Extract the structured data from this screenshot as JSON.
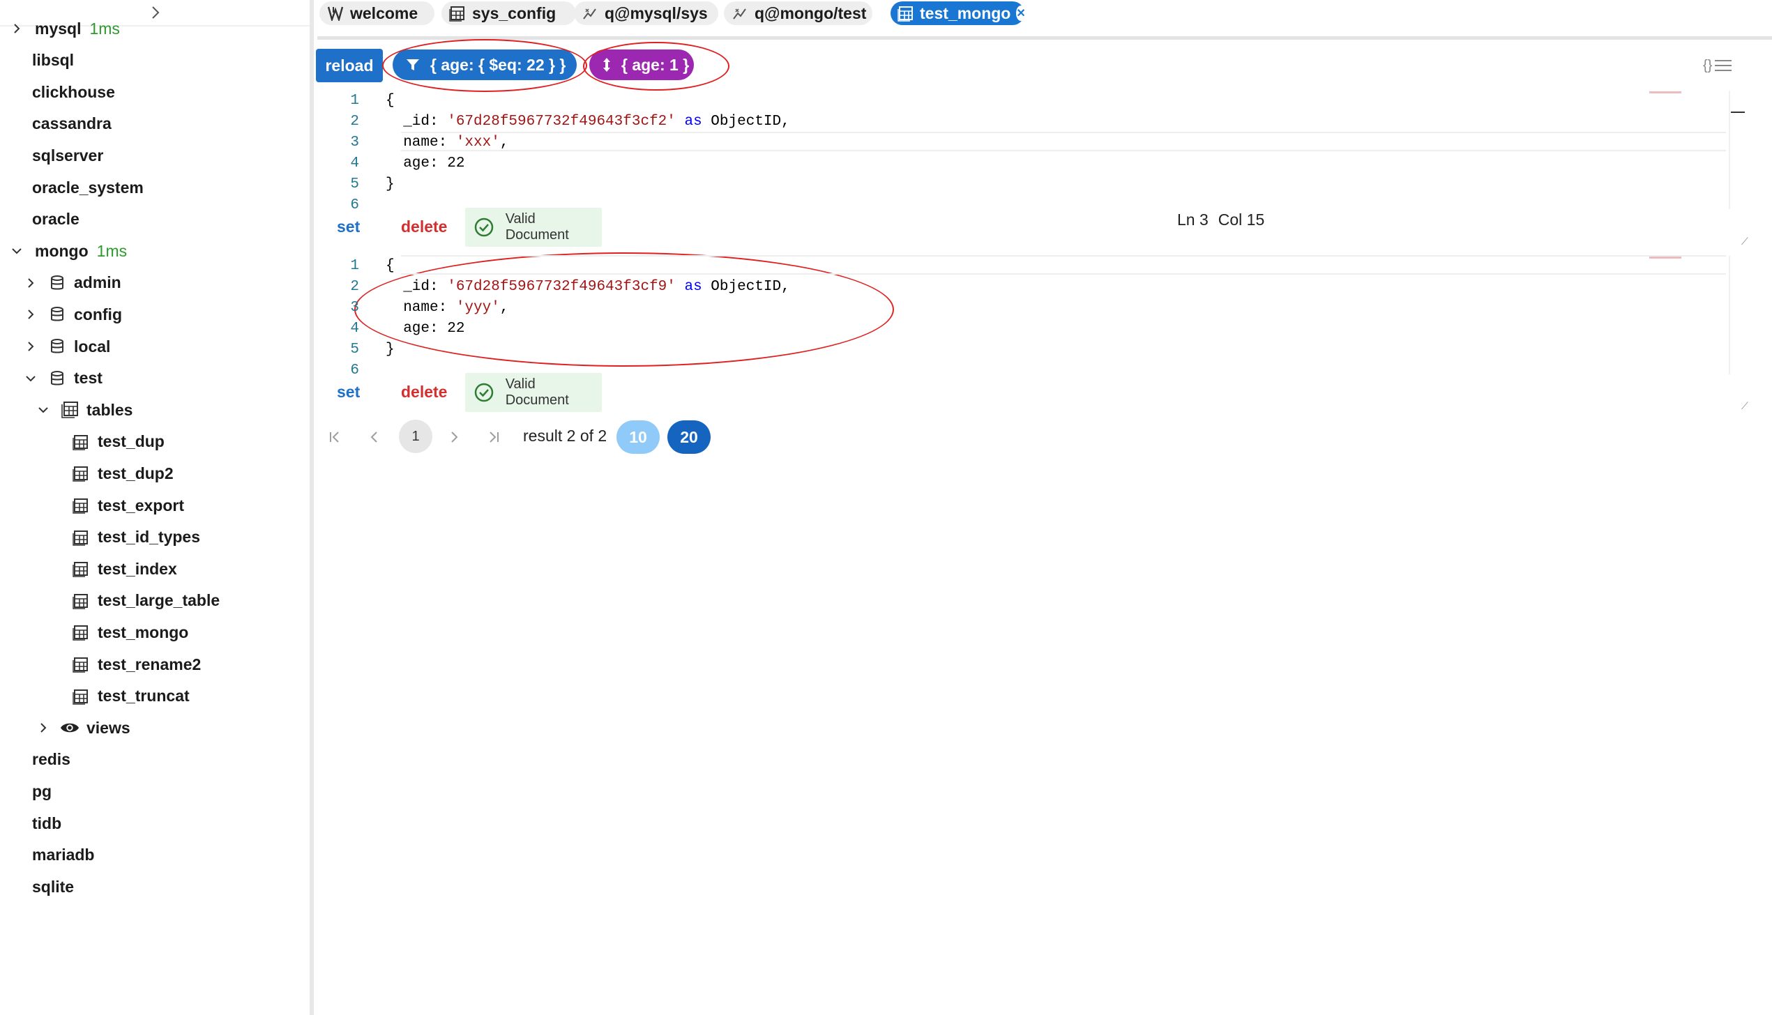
{
  "sidebar": {
    "items": [
      {
        "label": "mysql",
        "latency": "1ms",
        "expanded": false
      },
      {
        "label": "libsql"
      },
      {
        "label": "clickhouse"
      },
      {
        "label": "cassandra"
      },
      {
        "label": "sqlserver"
      },
      {
        "label": "oracle_system"
      },
      {
        "label": "oracle"
      },
      {
        "label": "mongo",
        "latency": "1ms",
        "expanded": true
      },
      {
        "label": "admin",
        "icon": "database-icon"
      },
      {
        "label": "config",
        "icon": "database-icon"
      },
      {
        "label": "local",
        "icon": "database-icon"
      },
      {
        "label": "test",
        "icon": "database-icon"
      },
      {
        "label": "tables",
        "icon": "table-group-icon"
      },
      {
        "label": "test_dup",
        "icon": "table-icon"
      },
      {
        "label": "test_dup2",
        "icon": "table-icon"
      },
      {
        "label": "test_export",
        "icon": "table-icon"
      },
      {
        "label": "test_id_types",
        "icon": "table-icon"
      },
      {
        "label": "test_index",
        "icon": "table-icon"
      },
      {
        "label": "test_large_table",
        "icon": "table-icon"
      },
      {
        "label": "test_mongo",
        "icon": "table-icon"
      },
      {
        "label": "test_rename2",
        "icon": "table-icon"
      },
      {
        "label": "test_truncat",
        "icon": "table-icon"
      },
      {
        "label": "views",
        "icon": "eye-icon"
      },
      {
        "label": "redis"
      },
      {
        "label": "pg"
      },
      {
        "label": "tidb"
      },
      {
        "label": "mariadb"
      },
      {
        "label": "sqlite"
      }
    ]
  },
  "tabs": [
    {
      "label": "welcome",
      "icon": "logo-icon"
    },
    {
      "label": "sys_config",
      "icon": "table-icon"
    },
    {
      "label": "q@mysql/sys",
      "icon": "query-icon"
    },
    {
      "label": "q@mongo/test",
      "icon": "query-icon"
    },
    {
      "label": "test_mongo",
      "icon": "table-icon",
      "active": true
    }
  ],
  "toolbar": {
    "reload_label": "reload",
    "filter_label": "{ age: { $eq: 22 } }",
    "sort_label": "{ age: 1 }"
  },
  "documents": [
    {
      "lines": [
        {
          "n": "1",
          "parts": [
            [
              "p",
              "{"
            ]
          ]
        },
        {
          "n": "2",
          "parts": [
            [
              "p",
              "  _id: "
            ],
            [
              "s",
              "'67d28f5967732f49643f3cf2'"
            ],
            [
              "p",
              " "
            ],
            [
              "k",
              "as"
            ],
            [
              "p",
              " ObjectID,"
            ]
          ]
        },
        {
          "n": "3",
          "parts": [
            [
              "p",
              "  name: "
            ],
            [
              "s",
              "'xxx'"
            ],
            [
              "p",
              ","
            ]
          ]
        },
        {
          "n": "4",
          "parts": [
            [
              "p",
              "  age: 22"
            ]
          ]
        },
        {
          "n": "5",
          "parts": [
            [
              "p",
              "}"
            ]
          ]
        },
        {
          "n": "6",
          "parts": [
            [
              "p",
              ""
            ]
          ]
        }
      ],
      "set_label": "set",
      "delete_label": "delete",
      "status_label": "Valid Document"
    },
    {
      "lines": [
        {
          "n": "1",
          "parts": [
            [
              "p",
              "{"
            ]
          ]
        },
        {
          "n": "2",
          "parts": [
            [
              "p",
              "  _id: "
            ],
            [
              "s",
              "'67d28f5967732f49643f3cf9'"
            ],
            [
              "p",
              " "
            ],
            [
              "k",
              "as"
            ],
            [
              "p",
              " ObjectID,"
            ]
          ]
        },
        {
          "n": "3",
          "parts": [
            [
              "p",
              "  name: "
            ],
            [
              "s",
              "'yyy'"
            ],
            [
              "p",
              ","
            ]
          ]
        },
        {
          "n": "4",
          "parts": [
            [
              "p",
              "  age: 22"
            ]
          ]
        },
        {
          "n": "5",
          "parts": [
            [
              "p",
              "}"
            ]
          ]
        },
        {
          "n": "6",
          "parts": [
            [
              "p",
              ""
            ]
          ]
        }
      ],
      "set_label": "set",
      "delete_label": "delete",
      "status_label": "Valid Document"
    }
  ],
  "cursor": {
    "ln": "Ln 3",
    "col": "Col 15"
  },
  "pagination": {
    "current_page": "1",
    "result_text": "result 2 of 2",
    "page_sizes": [
      "10",
      "20"
    ],
    "active_page_size": "20"
  },
  "colors": {
    "primary": "#1e70c8",
    "sort_chip": "#9c27b0",
    "delete": "#d32f2f",
    "latency": "#2e9a2e",
    "annotation": "#e02020"
  }
}
